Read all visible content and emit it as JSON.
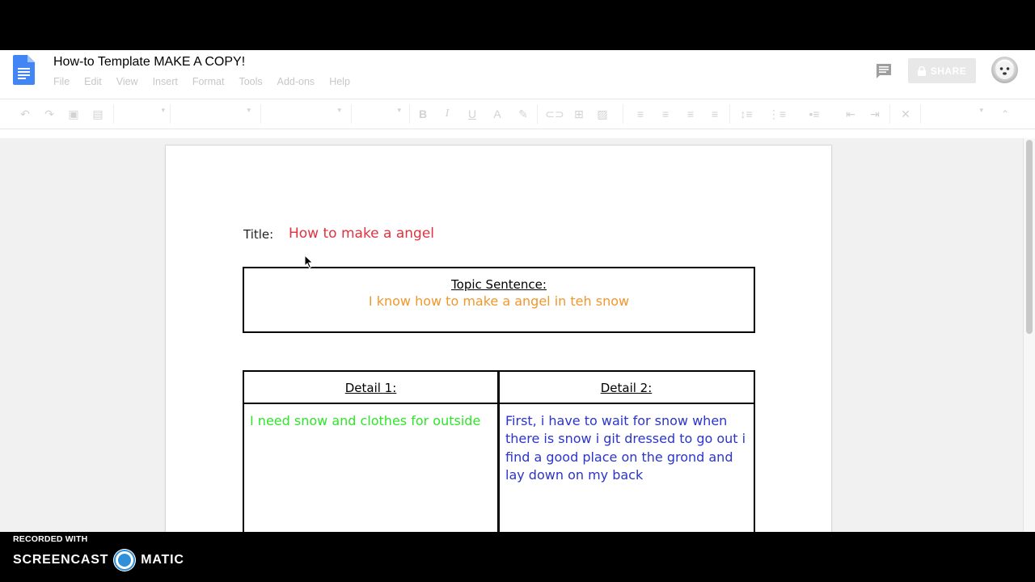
{
  "document": {
    "title": "How-to Template MAKE A COPY!"
  },
  "menu": [
    "File",
    "Edit",
    "View",
    "Insert",
    "Format",
    "Tools",
    "Add-ons",
    "Help"
  ],
  "share_button": {
    "label": "SHARE",
    "icon": "lock-icon"
  },
  "content": {
    "title_label": "Title:",
    "title_value": "How to make a angel",
    "topic_heading": "Topic Sentence:",
    "topic_text": "I know how to make a angel in teh snow",
    "detail1_heading": "Detail 1:",
    "detail1_text": "I need snow and clothes for outside",
    "detail2_heading": "Detail 2:",
    "detail2_text": "First, i have to wait for snow when there is snow i git dressed to go out i find  a good place on the grond and lay down on my back"
  },
  "watermark": {
    "line1": "RECORDED WITH",
    "brand_left": "SCREENCAST",
    "brand_right": "MATIC"
  },
  "colors": {
    "title_value": "#e0323f",
    "topic_text": "#f0972e",
    "detail1_text": "#2ee52a",
    "detail2_text": "#2b35c9",
    "docs_blue": "#4285f4"
  }
}
